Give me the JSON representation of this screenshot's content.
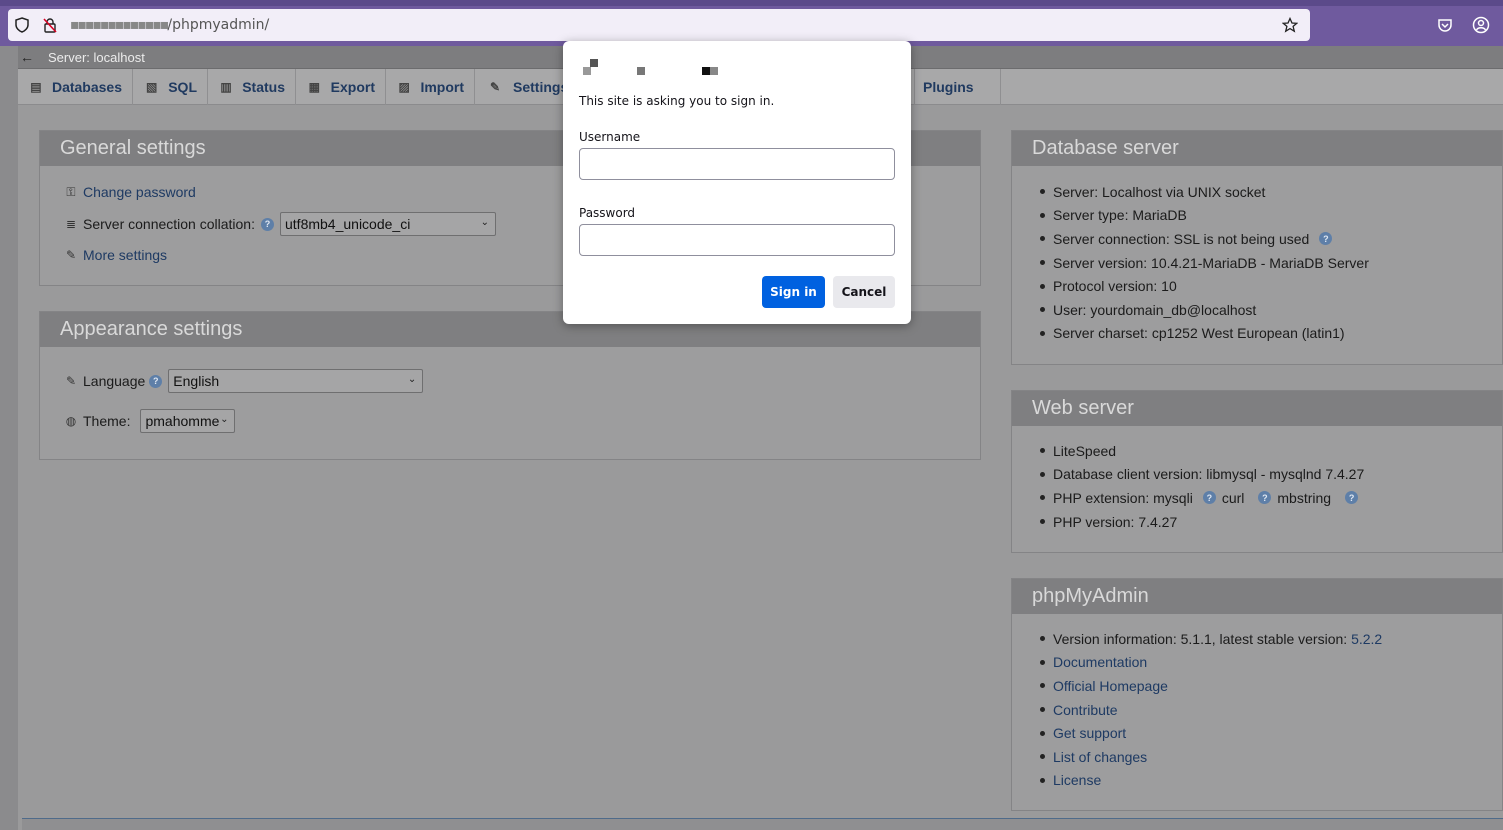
{
  "browser": {
    "url": "/phpmyadmin/",
    "url_host_redacted": "▪▪▪▪▪▪▪▪▪▪▪▪▪"
  },
  "breadcrumb": {
    "back": "←",
    "server": "Server: localhost"
  },
  "tabs": [
    {
      "label": "Databases",
      "icon": "database-icon"
    },
    {
      "label": "SQL",
      "icon": "sql-icon"
    },
    {
      "label": "Status",
      "icon": "status-icon"
    },
    {
      "label": "Export",
      "icon": "export-icon"
    },
    {
      "label": "Import",
      "icon": "import-icon"
    },
    {
      "label": "Settings",
      "icon": "wrench-icon"
    },
    {
      "label": "Plugins",
      "icon": "plugins-icon"
    }
  ],
  "general_settings": {
    "title": "General settings",
    "change_password": "Change password",
    "collation_label": "Server connection collation:",
    "collation_value": "utf8mb4_unicode_ci",
    "more_settings": "More settings"
  },
  "appearance_settings": {
    "title": "Appearance settings",
    "language_label": "Language",
    "language_value": "English",
    "theme_label": "Theme:",
    "theme_value": "pmahomme"
  },
  "database_server": {
    "title": "Database server",
    "items": [
      "Server: Localhost via UNIX socket",
      "Server type: MariaDB",
      "Server connection: SSL is not being used",
      "Server version: 10.4.21-MariaDB - MariaDB Server",
      "Protocol version: 10",
      "User: yourdomain_db@localhost",
      "Server charset: cp1252 West European (latin1)"
    ]
  },
  "web_server": {
    "title": "Web server",
    "items": [
      "LiteSpeed",
      "Database client version: libmysql - mysqlnd 7.4.27",
      "PHP extension: mysqli",
      "PHP version: 7.4.27"
    ],
    "ext_curl": "curl",
    "ext_mbstring": "mbstring"
  },
  "phpmyadmin": {
    "title": "phpMyAdmin",
    "version_text": "Version information: 5.1.1, latest stable version:",
    "version_link": "5.2.2",
    "links": [
      "Documentation",
      "Official Homepage",
      "Contribute",
      "Get support",
      "List of changes",
      "License"
    ]
  },
  "dialog": {
    "message": "This site is asking you to sign in.",
    "username_label": "Username",
    "password_label": "Password",
    "sign_in": "Sign in",
    "cancel": "Cancel"
  }
}
